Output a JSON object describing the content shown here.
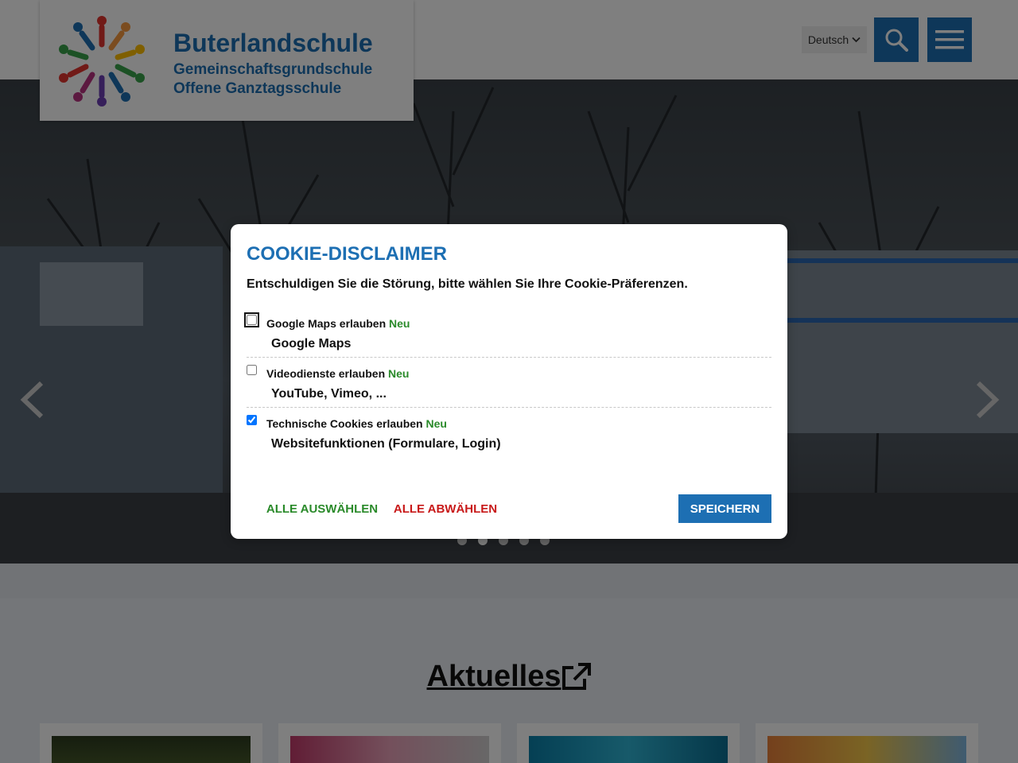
{
  "header": {
    "school_name": "Buterlandschule",
    "subtitle_1": "Gemeinschaftsgrundschule",
    "subtitle_2": "Offene Ganztagsschule",
    "language": "Deutsch",
    "search_icon": "search-icon",
    "menu_icon": "hamburger-menu-icon"
  },
  "slider": {
    "prev_icon": "chevron-left-icon",
    "next_icon": "chevron-right-icon",
    "dot_count": 5,
    "active_dot": 2
  },
  "section": {
    "title": "Aktuelles",
    "icon": "external-link-icon"
  },
  "cookie_dialog": {
    "title": "COOKIE-DISCLAIMER",
    "intro": "Entschuldigen Sie die Störung, bitte wählen Sie Ihre Cookie-Präferenzen.",
    "options": [
      {
        "label": "Google Maps erlauben",
        "badge": "Neu",
        "description": "Google Maps",
        "checked": false
      },
      {
        "label": "Videodienste erlauben",
        "badge": "Neu",
        "description": "YouTube, Vimeo, ...",
        "checked": false
      },
      {
        "label": "Technische Cookies erlauben",
        "badge": "Neu",
        "description": "Websitefunktionen (Formulare, Login)",
        "checked": true
      }
    ],
    "select_all": "ALLE AUSWÄHLEN",
    "deselect_all": "ALLE ABWÄHLEN",
    "save": "SPEICHERN"
  },
  "colors": {
    "brand_blue": "#1d6fb3",
    "accent_green": "#2a8a2a",
    "accent_red": "#c81919"
  }
}
